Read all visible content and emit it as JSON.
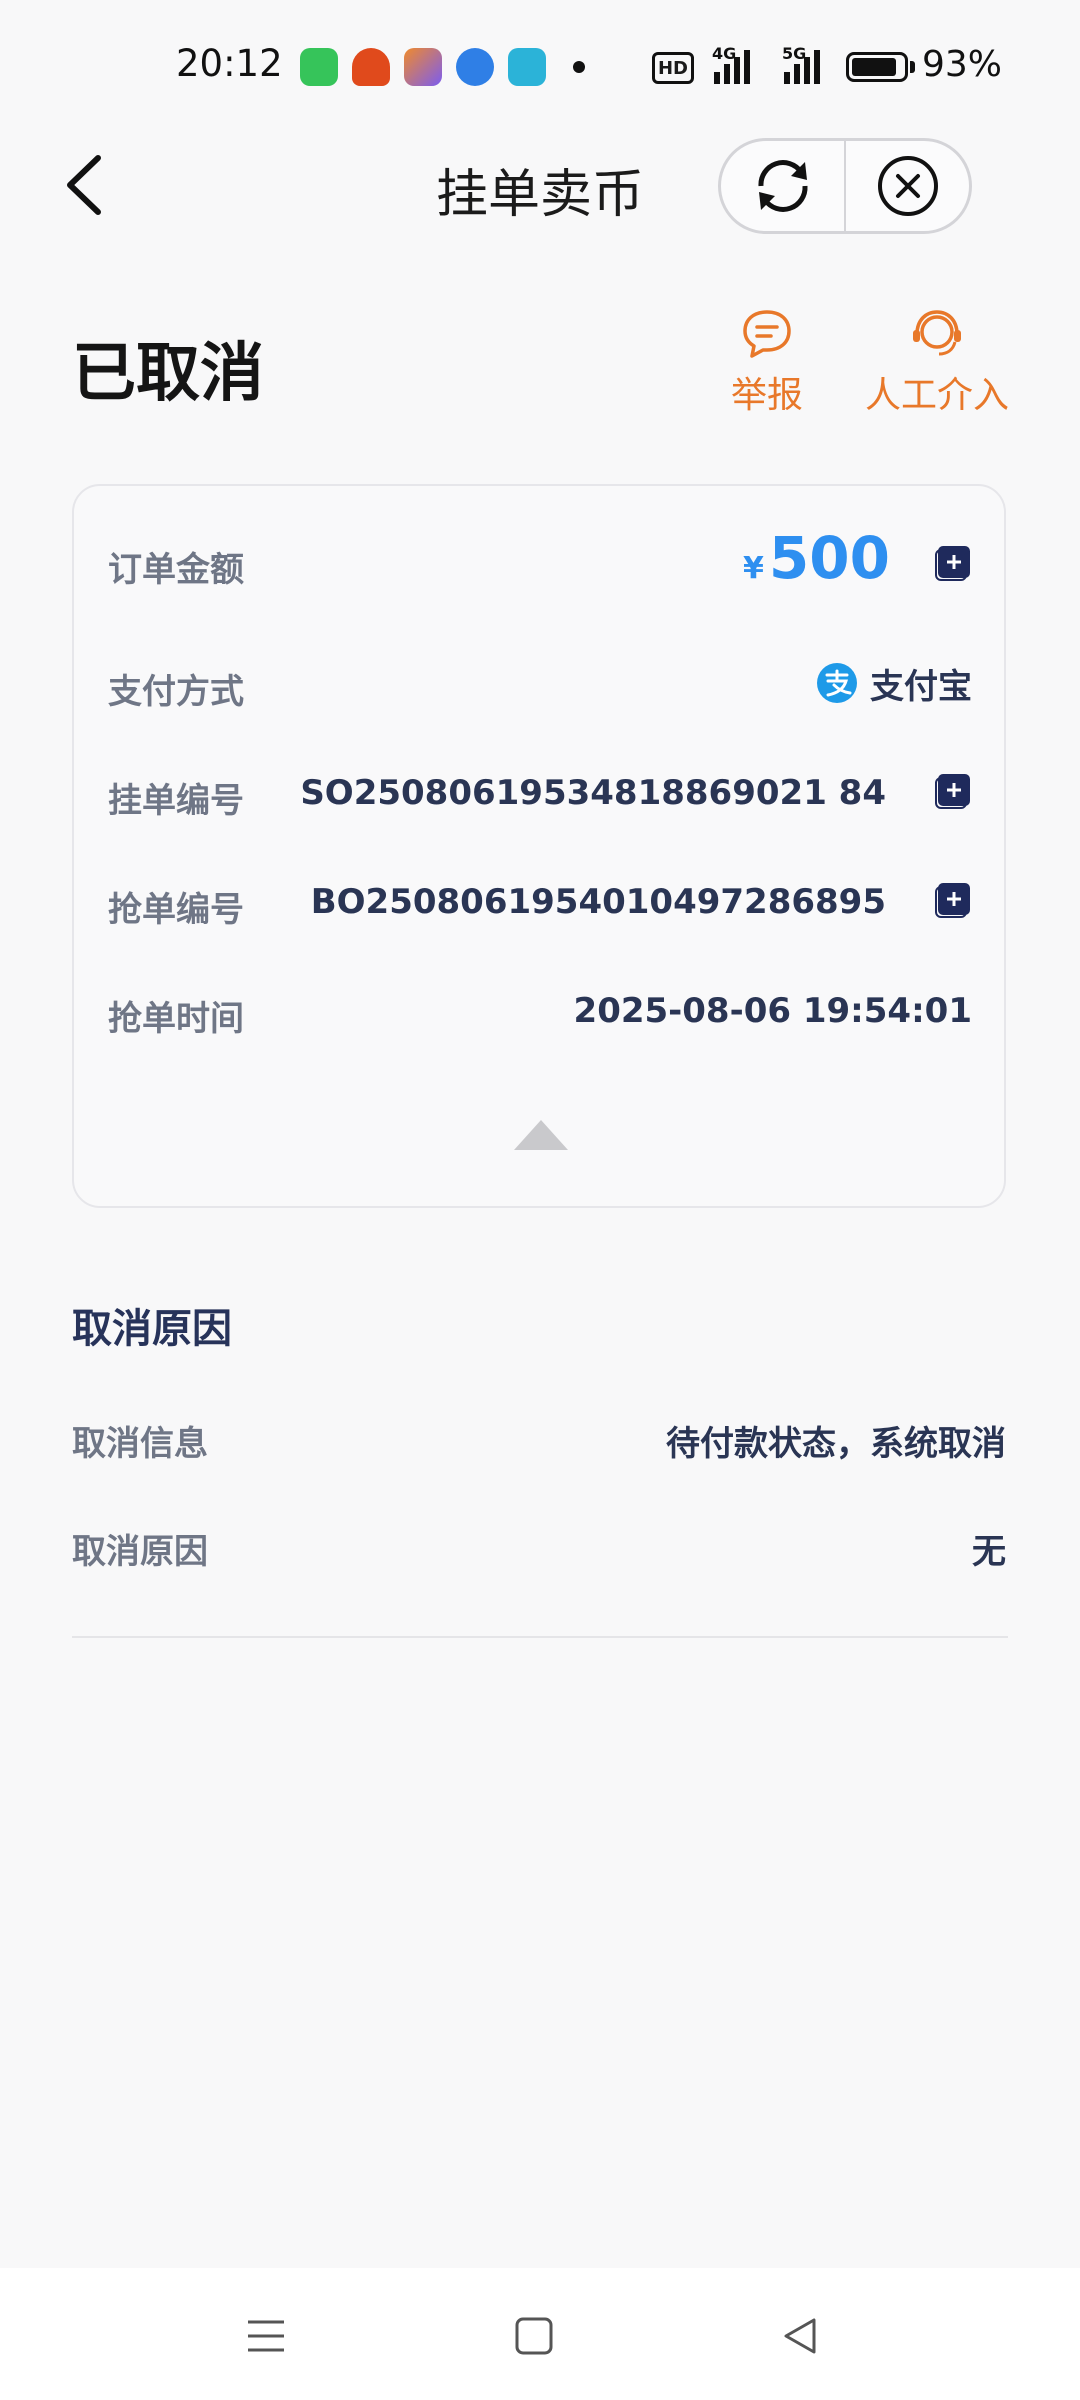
{
  "status_bar": {
    "time": "20:12",
    "hd_label": "HD",
    "net1": "4G",
    "net2": "5G",
    "battery_pct": "93%",
    "app_icons": [
      "shop-icon",
      "app-icon-red",
      "app-icon-multicolor",
      "app-icon-blue",
      "app-icon-teal"
    ],
    "app_colors": [
      "#36c45a",
      "#e04a1c",
      "#f08a2c",
      "#2f7fe6",
      "#2bb3d8"
    ]
  },
  "header": {
    "back_icon": "chevron-left-icon",
    "title": "挂单卖币",
    "refresh_icon": "refresh-icon",
    "close_icon": "close-circle-icon"
  },
  "order": {
    "status": "已取消",
    "actions": [
      {
        "label": "举报",
        "icon": "chat-bubble-icon"
      },
      {
        "label": "人工介入",
        "icon": "headset-icon"
      }
    ],
    "accent_color": "#e8782a",
    "details": {
      "amount_label": "订单金额",
      "currency_symbol": "¥",
      "amount": "500",
      "payment_label": "支付方式",
      "payment_value": "支付宝",
      "listing_no_label": "挂单编号",
      "listing_no": "SO25080619534818869021 84",
      "grab_no_label": "抢单编号",
      "grab_no": "BO2508061954010497286895",
      "grab_time_label": "抢单时间",
      "grab_time": "2025-08-06 19:54:01"
    }
  },
  "cancel": {
    "section_title": "取消原因",
    "info_label": "取消信息",
    "info_value": "待付款状态，系统取消",
    "reason_label": "取消原因",
    "reason_value": "无"
  },
  "navbar": {
    "icons": [
      "menu-icon",
      "home-square-icon",
      "back-triangle-icon"
    ]
  }
}
